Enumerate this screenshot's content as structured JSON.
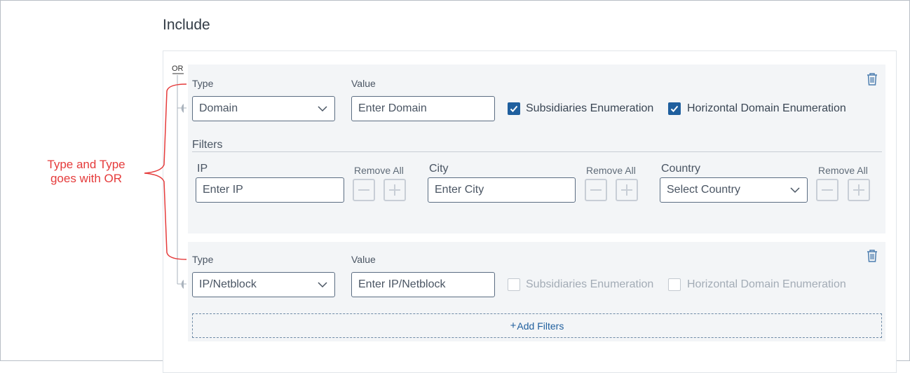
{
  "section": {
    "title": "Include"
  },
  "connector": {
    "or_label": "OR"
  },
  "annotation": {
    "text_line1": "Type and Type",
    "text_line2": "goes with OR",
    "color": "#e53b3b"
  },
  "rule1": {
    "type_label": "Type",
    "type_value": "Domain",
    "value_label": "Value",
    "value_placeholder": "Enter Domain",
    "subsidiaries": {
      "label": "Subsidiaries Enumeration",
      "checked": true
    },
    "horizontal": {
      "label": "Horizontal Domain Enumeration",
      "checked": true
    },
    "filters_label": "Filters",
    "filters": [
      {
        "label": "IP",
        "placeholder": "Enter IP",
        "remove_all": "Remove All"
      },
      {
        "label": "City",
        "placeholder": "Enter City",
        "remove_all": "Remove All"
      },
      {
        "label": "Country",
        "placeholder": "Select Country",
        "remove_all": "Remove All"
      }
    ]
  },
  "rule2": {
    "type_label": "Type",
    "type_value": "IP/Netblock",
    "value_label": "Value",
    "value_placeholder": "Enter IP/Netblock",
    "subsidiaries": {
      "label": "Subsidiaries Enumeration",
      "checked": false
    },
    "horizontal": {
      "label": "Horizontal Domain Enumeration",
      "checked": false
    },
    "add_filters": "Add Filters"
  },
  "icons": {
    "delete": "trash-icon",
    "dropdown": "chevron-down-icon",
    "minus": "minus-icon",
    "plus": "plus-icon",
    "check": "check-icon"
  },
  "colors": {
    "accent": "#1f5f9e",
    "panel": "#f3f5f7",
    "border": "#5b6d82"
  }
}
